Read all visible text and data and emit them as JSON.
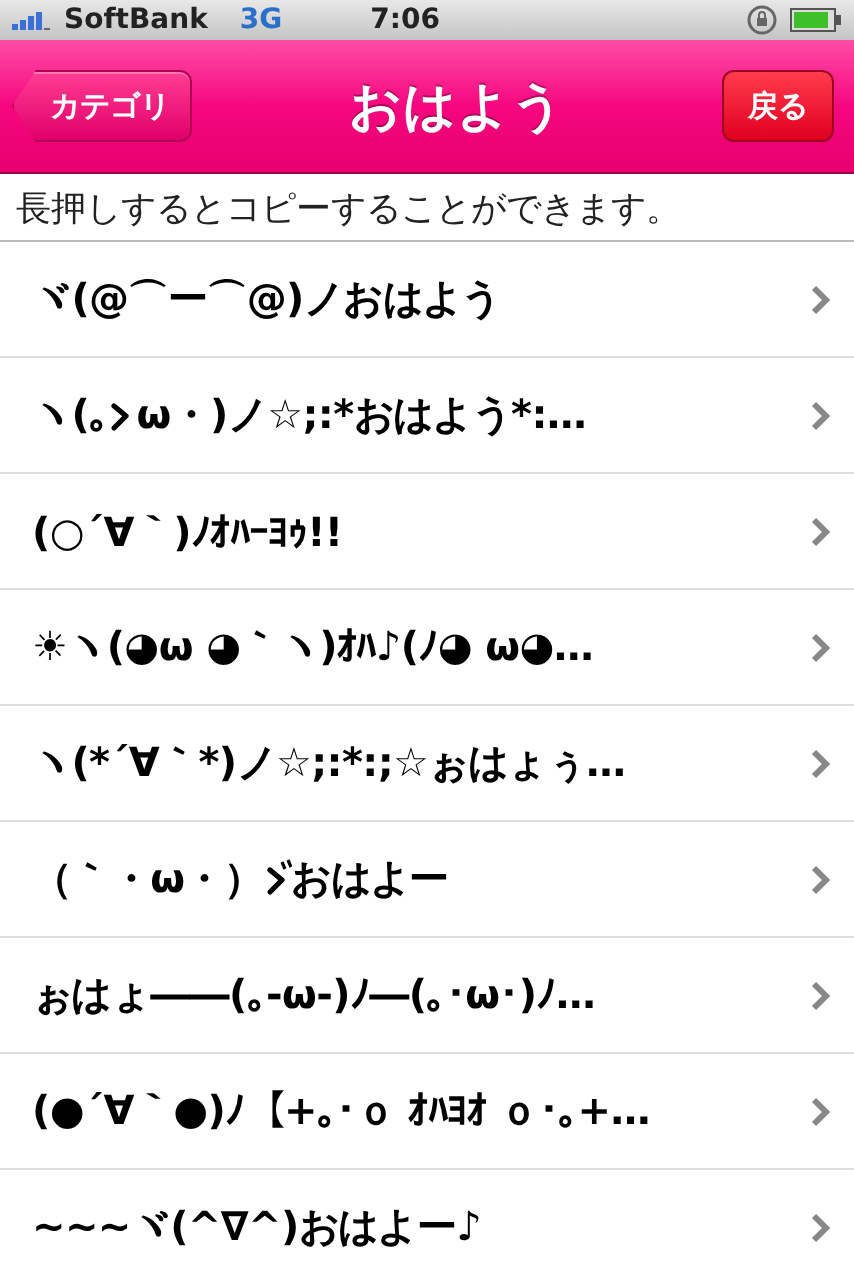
{
  "status_bar": {
    "carrier": "SoftBank",
    "network": "3G",
    "time": "7:06"
  },
  "nav": {
    "back_button": "カテゴリ",
    "title": "おはよう",
    "right_button": "戻る"
  },
  "hint": "長押しするとコピーすることができます。",
  "rows": [
    {
      "text": "ヾ(@⌒ー⌒@)ノおはよう"
    },
    {
      "segments": [
        {
          "kind": "text",
          "text": "ヽ(｡"
        },
        {
          "kind": "glyph",
          "voiced": false
        },
        {
          "kind": "text",
          "text": "ω・)ノ☆;:*おはよう*:…"
        }
      ]
    },
    {
      "text": "(○´∀｀)ﾉｵﾊｰﾖｩ!!"
    },
    {
      "text": "☀ヽ(◕ω ◕｀ヽ)ｵﾊ♪(ﾉ◕ ω◕…"
    },
    {
      "text": "ヽ(*´∀｀*)ノ☆;:*:;☆ぉはょぅ…"
    },
    {
      "segments": [
        {
          "kind": "text",
          "text": "（｀・ω・）"
        },
        {
          "kind": "glyph",
          "voiced": true
        },
        {
          "kind": "text",
          "text": "おはよー"
        }
      ]
    },
    {
      "text": "ぉはょ――(｡-ω-)ﾉ―(｡･ω･)ﾉ…"
    },
    {
      "text": "(●´∀｀●)ﾉ【+｡･ｏ ｵﾊﾖｵ ｏ･｡+…"
    },
    {
      "text": "~~~ヾ(^∇^)おはよー♪"
    }
  ]
}
